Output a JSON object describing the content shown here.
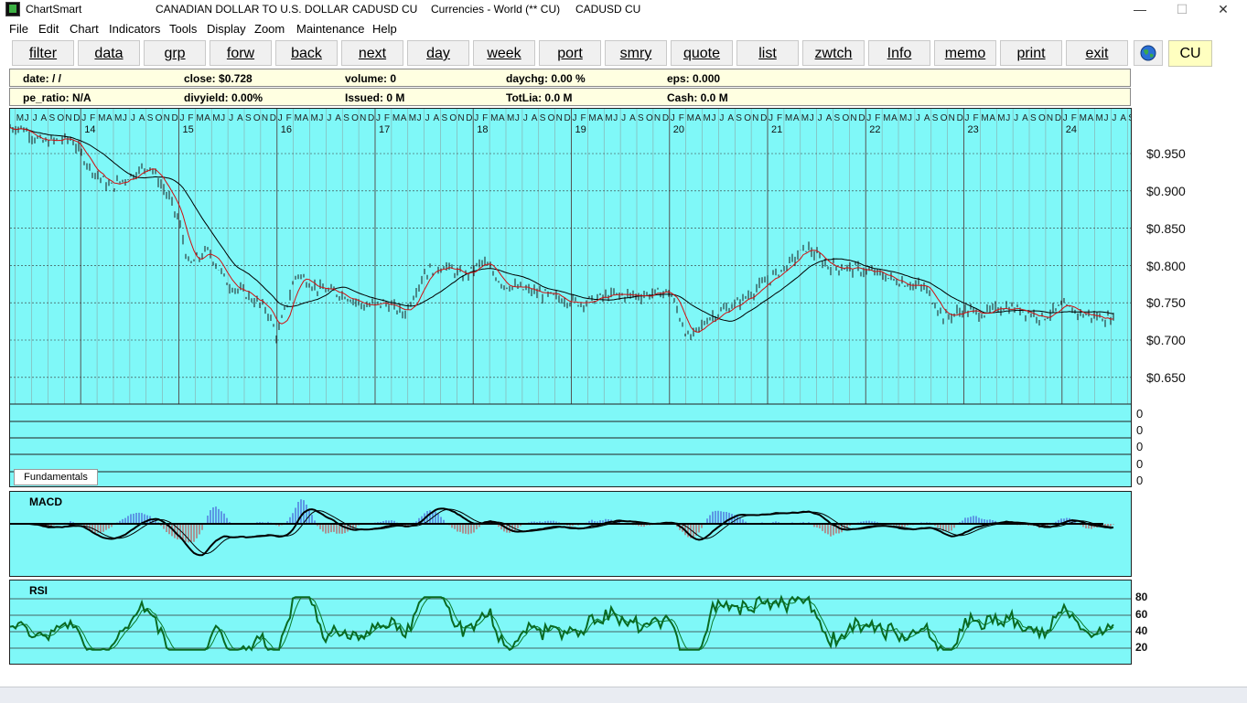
{
  "window": {
    "app_name": "ChartSmart",
    "title_parts": [
      "CANADIAN DOLLAR TO U.S. DOLLAR",
      "CADUSD CU",
      "Currencies - World (** CU)",
      "CADUSD CU"
    ],
    "controls": [
      "—",
      "☐",
      "✕"
    ]
  },
  "menu": [
    "File",
    "Edit",
    "Chart",
    "Indicators",
    "Tools",
    "Display",
    "Zoom",
    "Maintenance",
    "Help"
  ],
  "toolbar": {
    "buttons": [
      "filter",
      "data",
      "grp",
      "forw",
      "back",
      "next",
      "day",
      "week",
      "port",
      "smry",
      "quote",
      "list",
      "zwtch",
      "Info",
      "memo",
      "print",
      "exit"
    ],
    "globe_icon": "globe-icon",
    "exchange_code": "CU"
  },
  "info_row1": {
    "date": "date:  /  /",
    "close": "close: $0.728",
    "volume": "volume: 0",
    "daychg": "daychg: 0.00 %",
    "eps": "eps: 0.000"
  },
  "info_row2": {
    "pe_ratio": "pe_ratio: N/A",
    "divyield": "divyield: 0.00%",
    "issued": "Issued: 0 M",
    "totlia": "TotLia: 0.0 M",
    "cash": "Cash: 0.0 M"
  },
  "price_axis": [
    "$0.950",
    "$0.900",
    "$0.850",
    "$0.800",
    "$0.750",
    "$0.700",
    "$0.650"
  ],
  "year_labels": [
    "14",
    "15",
    "16",
    "17",
    "18",
    "19",
    "20",
    "21",
    "22",
    "23",
    "24"
  ],
  "fundamentals": {
    "button": "Fundamentals",
    "values": [
      "0",
      "0",
      "0",
      "0",
      "0"
    ]
  },
  "macd": {
    "label": "MACD"
  },
  "rsi": {
    "label": "RSI",
    "levels": [
      "80",
      "60",
      "40",
      "20"
    ]
  },
  "colors": {
    "chart_bg": "#7ff8f8",
    "info_bg": "#ffffe1",
    "price_bars": "#1a1a1a",
    "short_ma": "#d01010",
    "long_ma": "#000000",
    "rsi_line": "#0a7a2a",
    "macd_pos": "#3a3ad0",
    "macd_neg": "#d03030"
  },
  "chart_data": {
    "type": "line",
    "title": "CANADIAN DOLLAR TO U.S. DOLLAR",
    "xlabel": "",
    "ylabel": "",
    "x": [
      "2013.4",
      "2013.6",
      "2013.9",
      "2014.1",
      "2014.3",
      "2014.5",
      "2014.7",
      "2014.9",
      "2015.0",
      "2015.1",
      "2015.3",
      "2015.5",
      "2015.7",
      "2015.9",
      "2016.0",
      "2016.2",
      "2016.4",
      "2016.7",
      "2016.9",
      "2017.1",
      "2017.3",
      "2017.5",
      "2017.7",
      "2017.9",
      "2018.1",
      "2018.3",
      "2018.6",
      "2018.9",
      "2019.1",
      "2019.4",
      "2019.7",
      "2020.0",
      "2020.2",
      "2020.4",
      "2020.7",
      "2020.9",
      "2021.2",
      "2021.4",
      "2021.6",
      "2021.9",
      "2022.1",
      "2022.3",
      "2022.6",
      "2022.8",
      "2023.0",
      "2023.2",
      "2023.4",
      "2023.6",
      "2023.8",
      "2024.0",
      "2024.2",
      "2024.4",
      "2024.55"
    ],
    "series": [
      {
        "values": [
          0.985,
          0.965,
          0.97,
          0.93,
          0.905,
          0.92,
          0.935,
          0.89,
          0.86,
          0.8,
          0.82,
          0.775,
          0.76,
          0.74,
          0.705,
          0.79,
          0.77,
          0.76,
          0.745,
          0.75,
          0.735,
          0.79,
          0.8,
          0.785,
          0.805,
          0.775,
          0.765,
          0.755,
          0.75,
          0.76,
          0.76,
          0.765,
          0.7,
          0.73,
          0.75,
          0.77,
          0.8,
          0.825,
          0.8,
          0.795,
          0.79,
          0.78,
          0.77,
          0.73,
          0.74,
          0.735,
          0.745,
          0.74,
          0.73,
          0.745,
          0.735,
          0.73,
          0.728
        ]
      }
    ],
    "ylim": [
      0.63,
      1.0
    ]
  }
}
